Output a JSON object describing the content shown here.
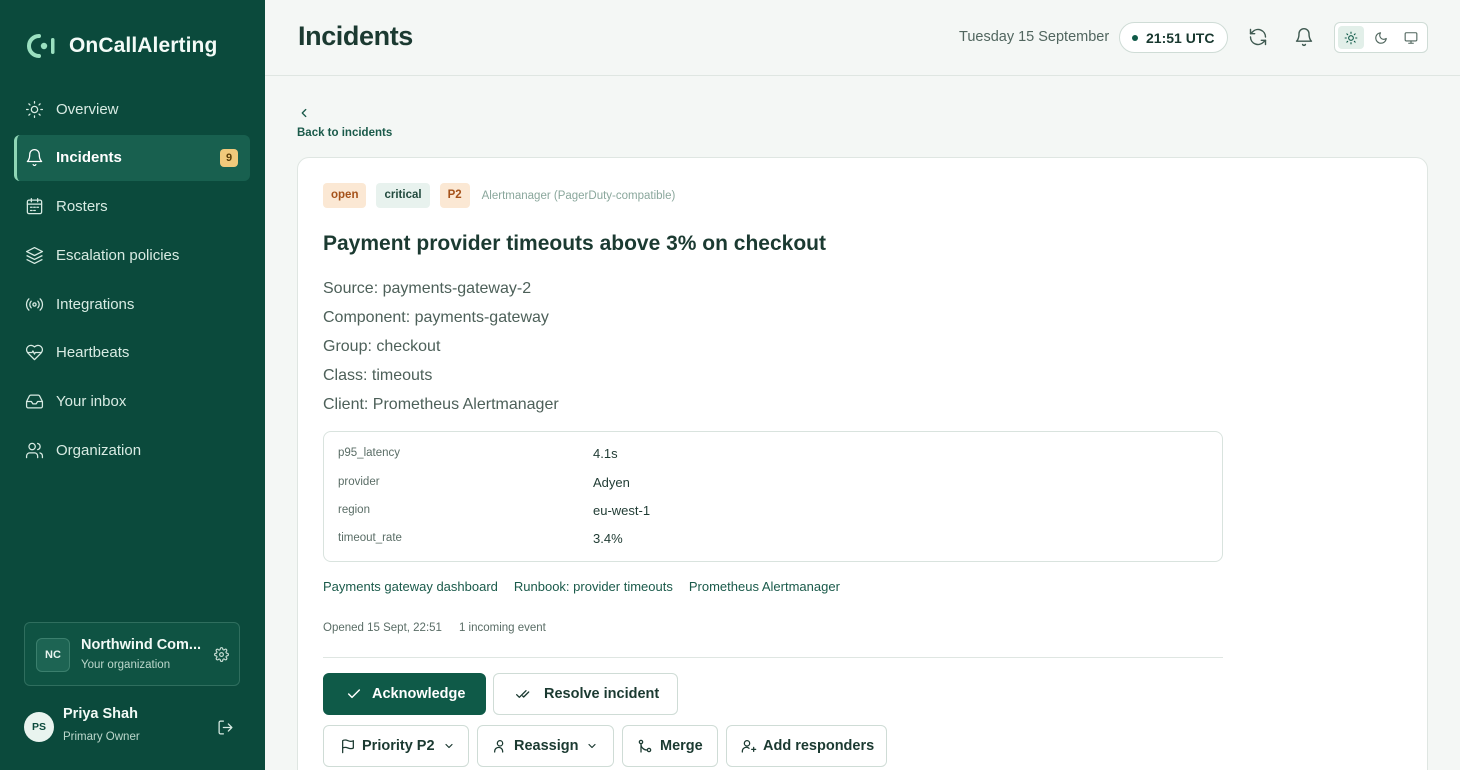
{
  "app": {
    "name": "OnCallAlerting"
  },
  "sidebar": {
    "items": [
      {
        "label": "Overview",
        "icon": "sun-icon"
      },
      {
        "label": "Incidents",
        "icon": "bell-icon",
        "badge": "9",
        "active": true
      },
      {
        "label": "Rosters",
        "icon": "calendar-icon"
      },
      {
        "label": "Escalation policies",
        "icon": "layers-icon"
      },
      {
        "label": "Integrations",
        "icon": "broadcast-icon"
      },
      {
        "label": "Heartbeats",
        "icon": "heart-pulse-icon"
      },
      {
        "label": "Your inbox",
        "icon": "inbox-icon"
      },
      {
        "label": "Organization",
        "icon": "users-icon"
      }
    ],
    "org": {
      "initials": "NC",
      "name": "Northwind Com...",
      "subtitle": "Your organization"
    },
    "user": {
      "initials": "PS",
      "name": "Priya Shah",
      "role": "Primary Owner"
    }
  },
  "header": {
    "title": "Incidents",
    "date": "Tuesday 15 September",
    "time": "21:51 UTC"
  },
  "back": {
    "label": "Back to incidents"
  },
  "incident": {
    "status": "open",
    "severity": "critical",
    "priority": "P2",
    "source_tag": "Alertmanager (PagerDuty-compatible)",
    "title": "Payment provider timeouts above 3% on checkout",
    "meta": [
      "Source: payments-gateway-2",
      "Component: payments-gateway",
      "Group: checkout",
      "Class: timeouts",
      "Client: Prometheus Alertmanager"
    ],
    "details": [
      {
        "key": "p95_latency",
        "value": "4.1s"
      },
      {
        "key": "provider",
        "value": "Adyen"
      },
      {
        "key": "region",
        "value": "eu-west-1"
      },
      {
        "key": "timeout_rate",
        "value": "3.4%"
      }
    ],
    "links": [
      "Payments gateway dashboard",
      "Runbook: provider timeouts",
      "Prometheus Alertmanager"
    ],
    "opened": "Opened 15 Sept, 22:51",
    "events": "1 incoming event"
  },
  "actions": {
    "acknowledge": "Acknowledge",
    "resolve": "Resolve incident",
    "priority": "Priority P2",
    "reassign": "Reassign",
    "merge": "Merge",
    "add_responders": "Add responders"
  },
  "colors": {
    "sidebar": "#0b4a3c",
    "accent": "#0f5a48",
    "badge": "#f1c97b",
    "tag_warm": "#fbe8d4"
  }
}
